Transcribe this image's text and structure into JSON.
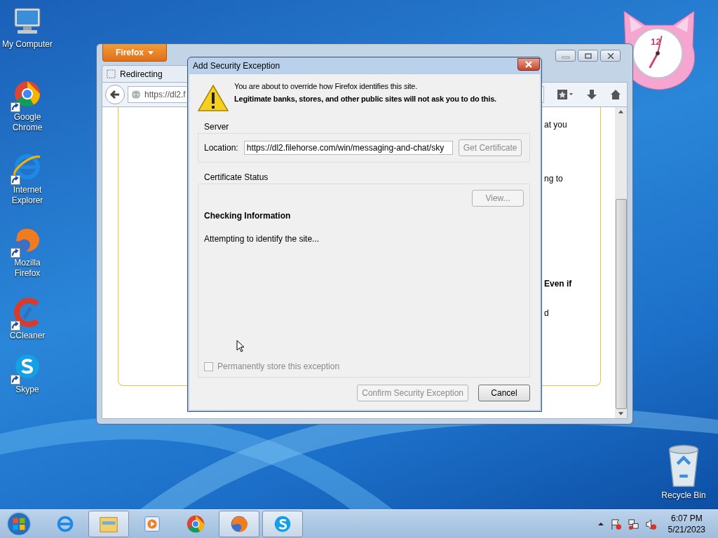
{
  "desktop_icons": [
    {
      "label": "My Computer",
      "kind": "computer",
      "shortcut": false
    },
    {
      "label": "Google Chrome",
      "kind": "chrome",
      "shortcut": true
    },
    {
      "label": "Internet Explorer",
      "kind": "ie",
      "shortcut": true
    },
    {
      "label": "Mozilla Firefox",
      "kind": "firefox",
      "shortcut": true
    },
    {
      "label": "CCleaner",
      "kind": "ccleaner",
      "shortcut": true
    },
    {
      "label": "Skype",
      "kind": "skype",
      "shortcut": true
    }
  ],
  "recycle_bin": {
    "label": "Recycle Bin"
  },
  "clock_gadget": {
    "numeral": "12"
  },
  "browser": {
    "menu_button": "Firefox",
    "tab": {
      "title": "Redirecting"
    },
    "url": "https://dl2.f",
    "page_fragments": [
      {
        "text": "at you",
        "bold": false
      },
      {
        "text": "ng to",
        "bold": false
      },
      {
        "text": "Even if",
        "bold": true
      },
      {
        "text": "d",
        "bold": false
      }
    ]
  },
  "dialog": {
    "title": "Add Security Exception",
    "warning": [
      "You are about to override how Firefox identifies this site.",
      "Legitimate banks, stores, and other public sites will not ask you to do this."
    ],
    "server": {
      "legend": "Server",
      "location_label": "Location:",
      "location_value": "https://dl2.filehorse.com/win/messaging-and-chat/sky",
      "get_certificate": {
        "label": "Get Certificate",
        "disabled": true
      }
    },
    "certificate_status": {
      "legend": "Certificate Status",
      "view": {
        "label": "View...",
        "disabled": true
      },
      "heading": "Checking Information",
      "message": "Attempting to identify the site...",
      "permanent": {
        "label": "Permanently store this exception",
        "checked": false,
        "disabled": true
      }
    },
    "buttons": [
      {
        "label": "Confirm Security Exception",
        "disabled": true
      },
      {
        "label": "Cancel",
        "disabled": false
      }
    ]
  },
  "taskbar": {
    "items": [
      {
        "kind": "ie",
        "running": false
      },
      {
        "kind": "explorer",
        "running": true
      },
      {
        "kind": "media",
        "running": false
      },
      {
        "kind": "chrome",
        "running": false
      },
      {
        "kind": "firefox",
        "running": true
      },
      {
        "kind": "skype",
        "running": true
      }
    ],
    "time": "6:07 PM",
    "date": "5/21/2023"
  }
}
